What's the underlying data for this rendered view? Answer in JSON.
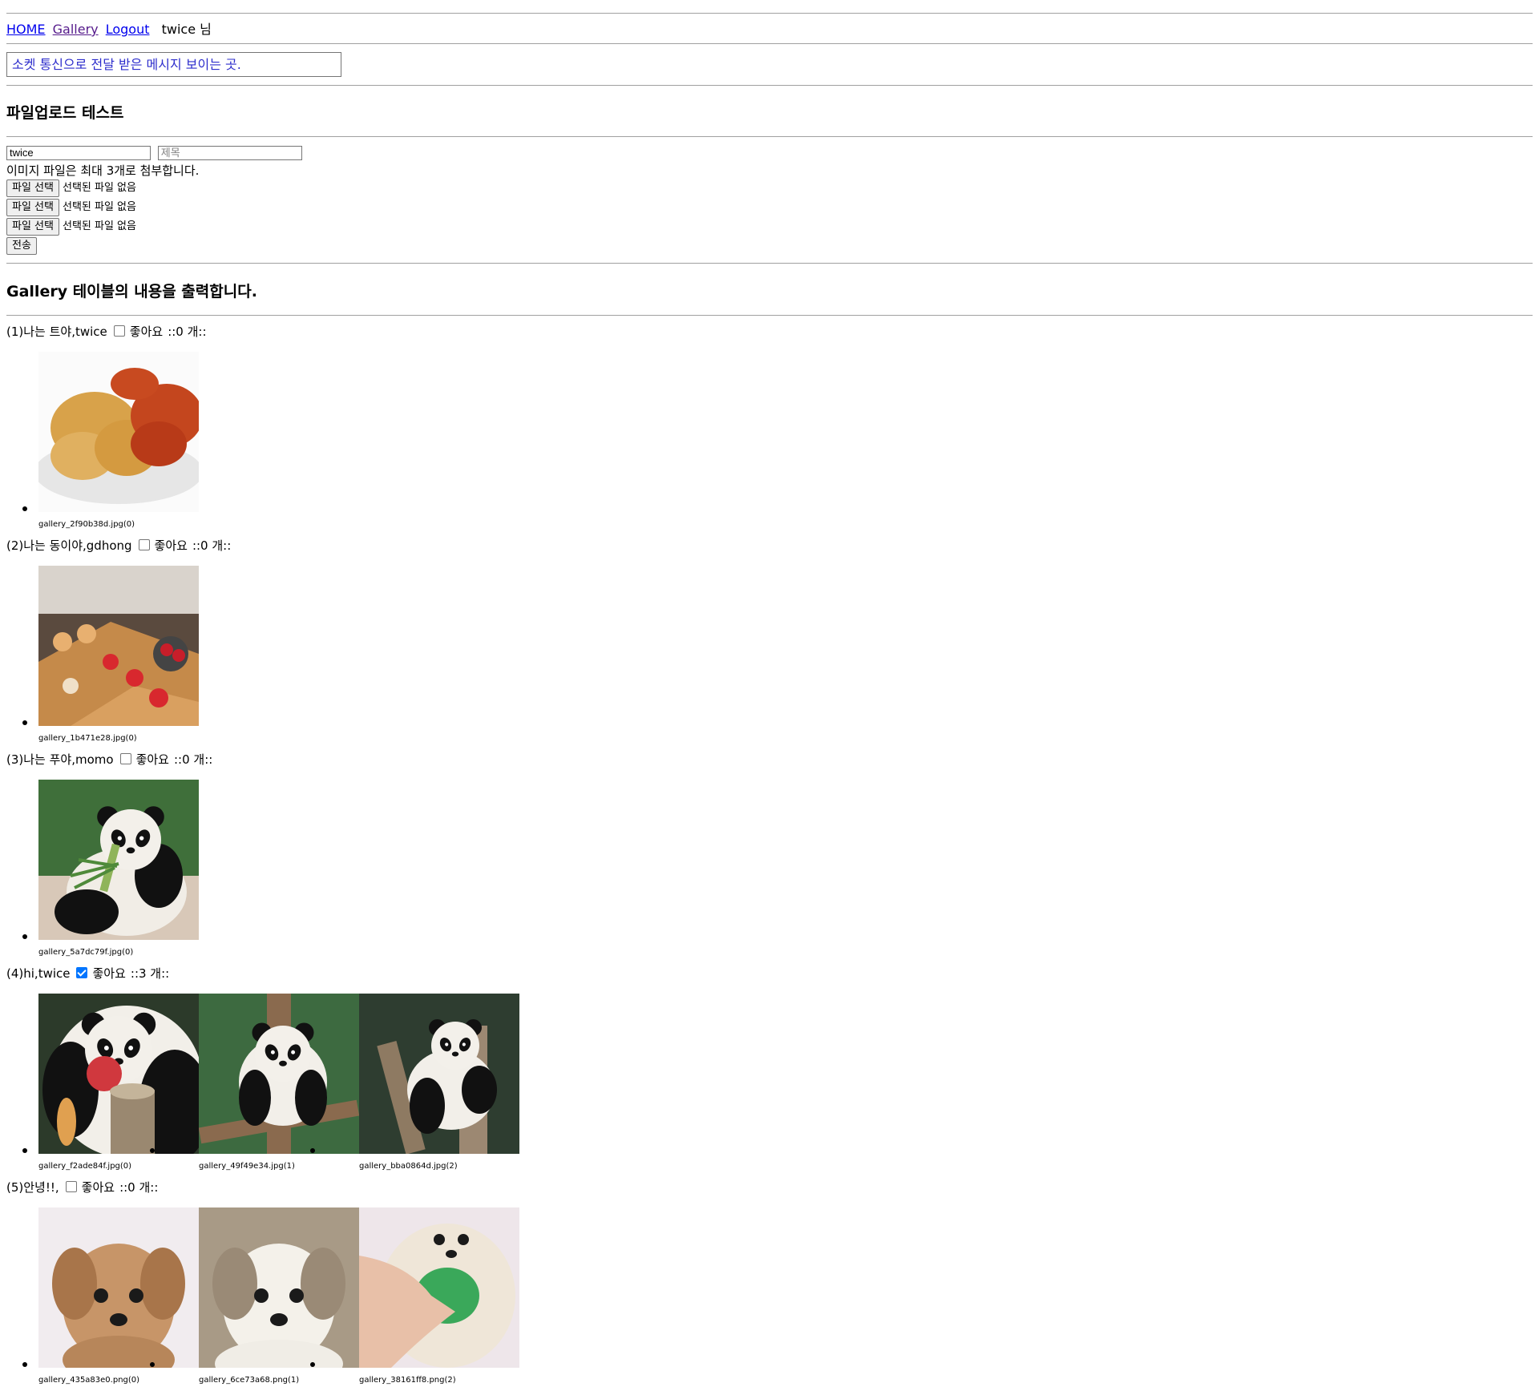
{
  "nav": {
    "home": "HOME",
    "gallery": "Gallery",
    "logout": "Logout",
    "user": "twice",
    "suffix": "님"
  },
  "socket_message": "소켓 통신으로 전달 받은 메시지 보이는 곳.",
  "upload": {
    "heading": "파일업로드 테스트",
    "writer_value": "twice",
    "title_placeholder": "제목",
    "note": "이미지 파일은 최대 3개로 첨부합니다.",
    "file_button": "파일 선택",
    "no_file": "선택된 파일 없음",
    "submit": "전송"
  },
  "gallery": {
    "heading": "Gallery 테이블의 내용을 출력합니다.",
    "like_label": "좋아요",
    "posts": [
      {
        "title": "(1)나는 트야,twice",
        "liked": false,
        "likes": "::0 개::",
        "images": [
          {
            "caption": "gallery_2f90b38d.jpg(0)",
            "subject": "fried-chicken"
          }
        ]
      },
      {
        "title": "(2)나는 동이야,gdhong",
        "liked": false,
        "likes": "::0 개::",
        "images": [
          {
            "caption": "gallery_1b471e28.jpg(0)",
            "subject": "dessert-buffet"
          }
        ]
      },
      {
        "title": "(3)나는 푸야,momo",
        "liked": false,
        "likes": "::0 개::",
        "images": [
          {
            "caption": "gallery_5a7dc79f.jpg(0)",
            "subject": "panda-eating-bamboo"
          }
        ]
      },
      {
        "title": "(4)hi,twice",
        "liked": true,
        "likes": "::3 개::",
        "images": [
          {
            "caption": "gallery_f2ade84f.jpg(0)",
            "subject": "panda-with-apple"
          },
          {
            "caption": "gallery_49f49e34.jpg(1)",
            "subject": "panda-on-tree"
          },
          {
            "caption": "gallery_bba0864d.jpg(2)",
            "subject": "panda-on-stump"
          }
        ]
      },
      {
        "title": "(5)안녕!!,",
        "liked": false,
        "likes": "::0 개::",
        "images": [
          {
            "caption": "gallery_435a83e0.png(0)",
            "subject": "brown-puppy"
          },
          {
            "caption": "gallery_6ce73a68.png(1)",
            "subject": "white-puppy"
          },
          {
            "caption": "gallery_38161ff8.png(2)",
            "subject": "puppy-with-hand"
          }
        ]
      }
    ]
  }
}
